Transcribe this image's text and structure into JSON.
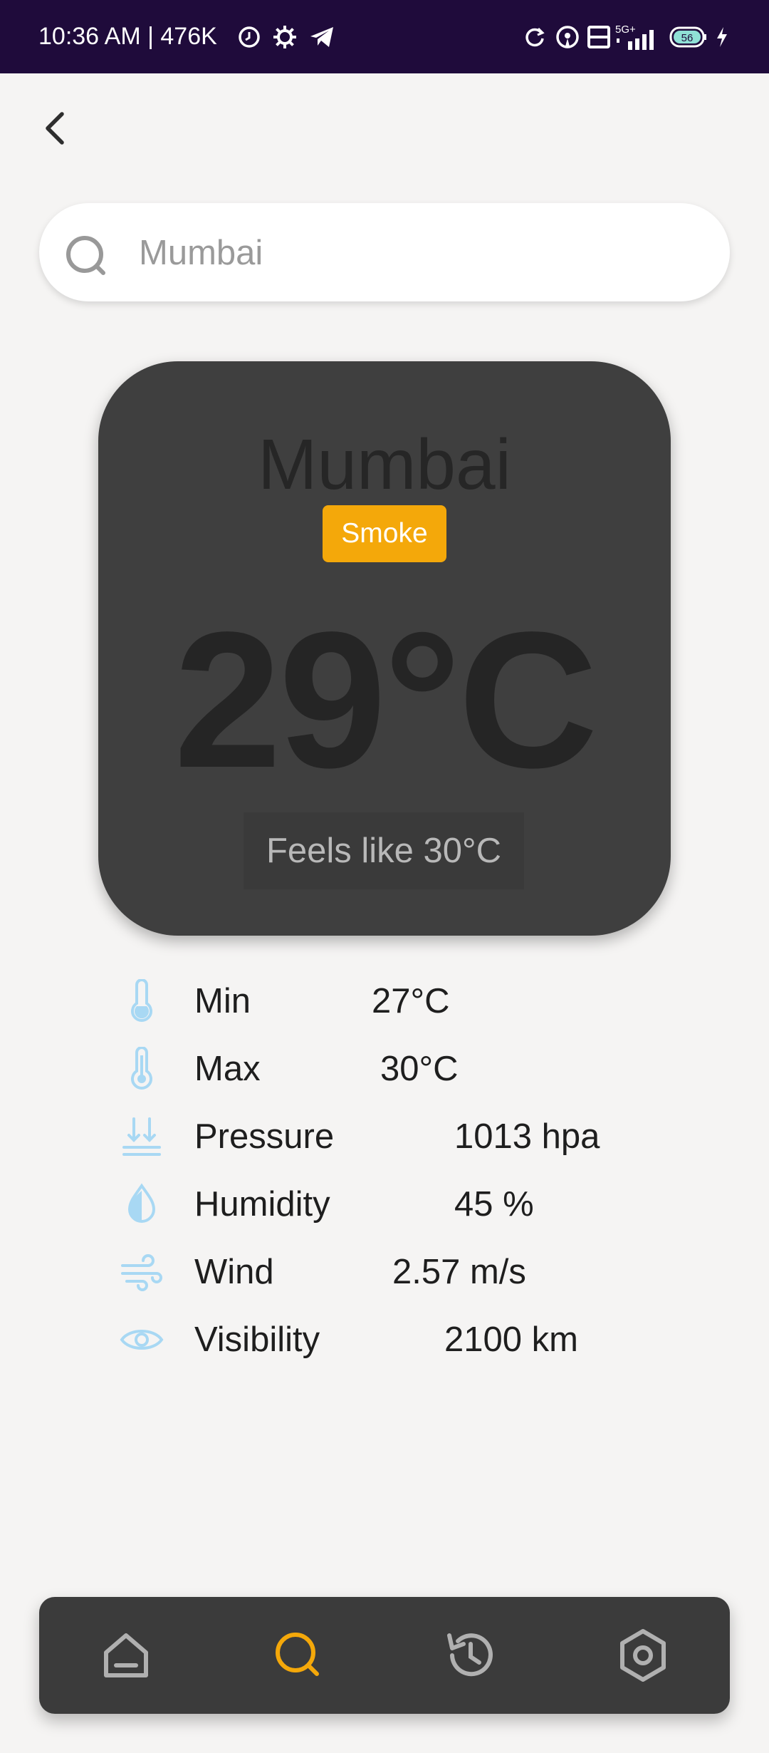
{
  "status_bar": {
    "time": "10:36 AM | 476K",
    "battery": "56"
  },
  "search": {
    "value": "",
    "placeholder": "Mumbai"
  },
  "weather": {
    "city": "Mumbai",
    "condition": "Smoke",
    "temperature": "29°C",
    "feels_like": "Feels like 30°C"
  },
  "details": [
    {
      "icon": "thermometer-low-icon",
      "label": "Min",
      "value": "27°C"
    },
    {
      "icon": "thermometer-high-icon",
      "label": "Max",
      "value": "30°C"
    },
    {
      "icon": "pressure-icon",
      "label": "Pressure",
      "value": "1013 hpa"
    },
    {
      "icon": "humidity-icon",
      "label": "Humidity",
      "value": "45 %"
    },
    {
      "icon": "wind-icon",
      "label": "Wind",
      "value": "2.57 m/s"
    },
    {
      "icon": "visibility-icon",
      "label": "Visibility",
      "value": "2100 km"
    }
  ],
  "nav": {
    "active": "search",
    "items": [
      "home",
      "search",
      "history",
      "settings"
    ]
  },
  "colors": {
    "accent": "#f4a80a",
    "detail_icon": "#a8d8f3",
    "card": "#3f3f3f",
    "status_bar": "#1f0b3b"
  }
}
